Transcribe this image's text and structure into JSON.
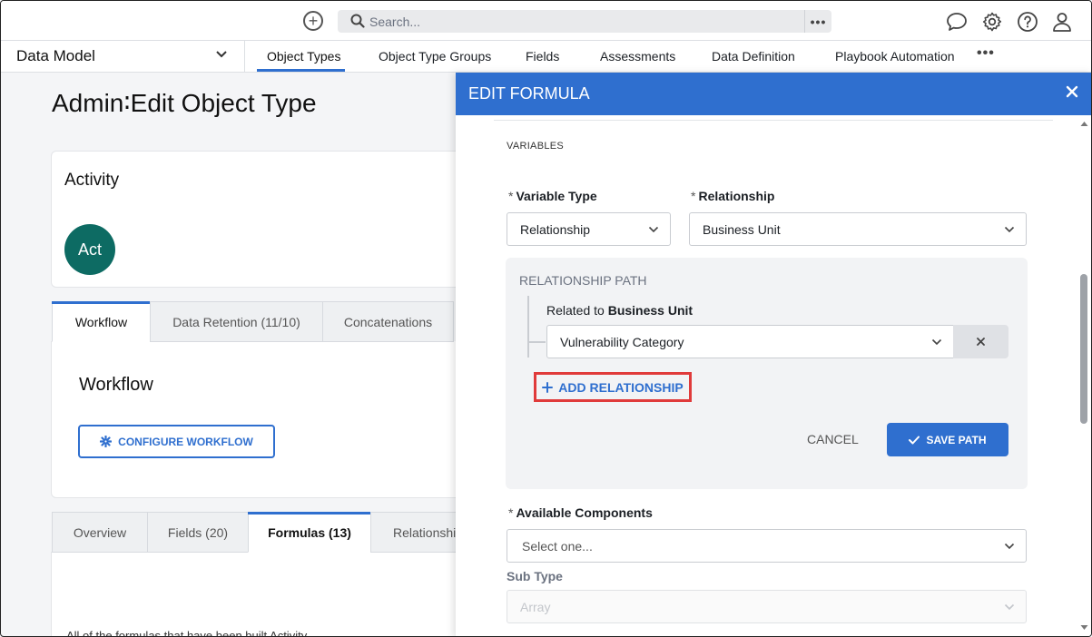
{
  "topbar": {
    "search_placeholder": "Search...",
    "more_label": "•••",
    "icons": [
      "add-circle-icon",
      "search-icon",
      "chat-icon",
      "gear-icon",
      "help-icon",
      "user-icon"
    ]
  },
  "nav": {
    "module": "Data Model",
    "tabs": [
      {
        "label": "Object Types",
        "active": true
      },
      {
        "label": "Object Type Groups"
      },
      {
        "label": "Fields"
      },
      {
        "label": "Assessments"
      },
      {
        "label": "Data Definition"
      },
      {
        "label": "Playbook Automation"
      }
    ],
    "more_label": "•••"
  },
  "page": {
    "title": "Admin∶Edit Object Type",
    "activity_title": "Activity",
    "avatar_text": "Act",
    "tabs": [
      {
        "label": "Workflow",
        "active": true
      },
      {
        "label": "Data Retention (11/10)"
      },
      {
        "label": "Concatenations"
      }
    ],
    "workflow_title": "Workflow",
    "configure_button": "CONFIGURE WORKFLOW",
    "lower_tabs": [
      {
        "label": "Overview"
      },
      {
        "label": "Fields (20)"
      },
      {
        "label": "Formulas (13)",
        "active": true
      },
      {
        "label": "Relationshi"
      }
    ],
    "bottom_text": "All of the formulas that have been built Activity"
  },
  "drawer": {
    "title": "EDIT FORMULA",
    "variables_label": "VARIABLES",
    "required_mark": "*",
    "variable_type": {
      "label": "Variable Type",
      "value": "Relationship"
    },
    "relationship": {
      "label": "Relationship",
      "value": "Business Unit"
    },
    "relationship_path": {
      "title": "RELATIONSHIP PATH",
      "related_prefix": "Related to",
      "related_name": "Business Unit",
      "selected": "Vulnerability Category",
      "remove_label": "×",
      "add_button": "ADD RELATIONSHIP",
      "cancel_button": "CANCEL",
      "save_button": "SAVE PATH"
    },
    "available_components": {
      "label": "Available Components",
      "placeholder": "Select one..."
    },
    "sub_type": {
      "label": "Sub Type",
      "value": "Array"
    }
  },
  "colors": {
    "accent": "#2f6fcf",
    "highlight": "#e03a3a",
    "avatar": "#0d6b63"
  }
}
